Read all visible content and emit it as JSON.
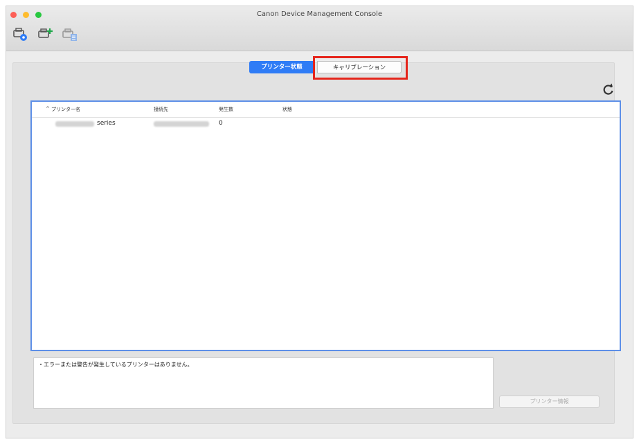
{
  "window": {
    "title": "Canon Device Management Console"
  },
  "toolbar": {
    "icons": [
      "printer-settings-icon",
      "add-printer-icon",
      "printer-info-icon"
    ]
  },
  "tabs": [
    {
      "label": "プリンター状態",
      "active": true
    },
    {
      "label": "キャリブレーション",
      "active": false
    }
  ],
  "table": {
    "columns": [
      "プリンター名",
      "接続先",
      "発生数",
      "状態"
    ],
    "rows": [
      {
        "name": "series",
        "count": "0",
        "status": ""
      }
    ]
  },
  "message": "・エラーまたは警告が発生しているプリンターはありません。",
  "buttons": {
    "printer_info": "プリンター情報"
  },
  "colors": {
    "accent": "#2f7cf6",
    "highlight": "#e5251b",
    "table_border": "#5d8fe8"
  }
}
